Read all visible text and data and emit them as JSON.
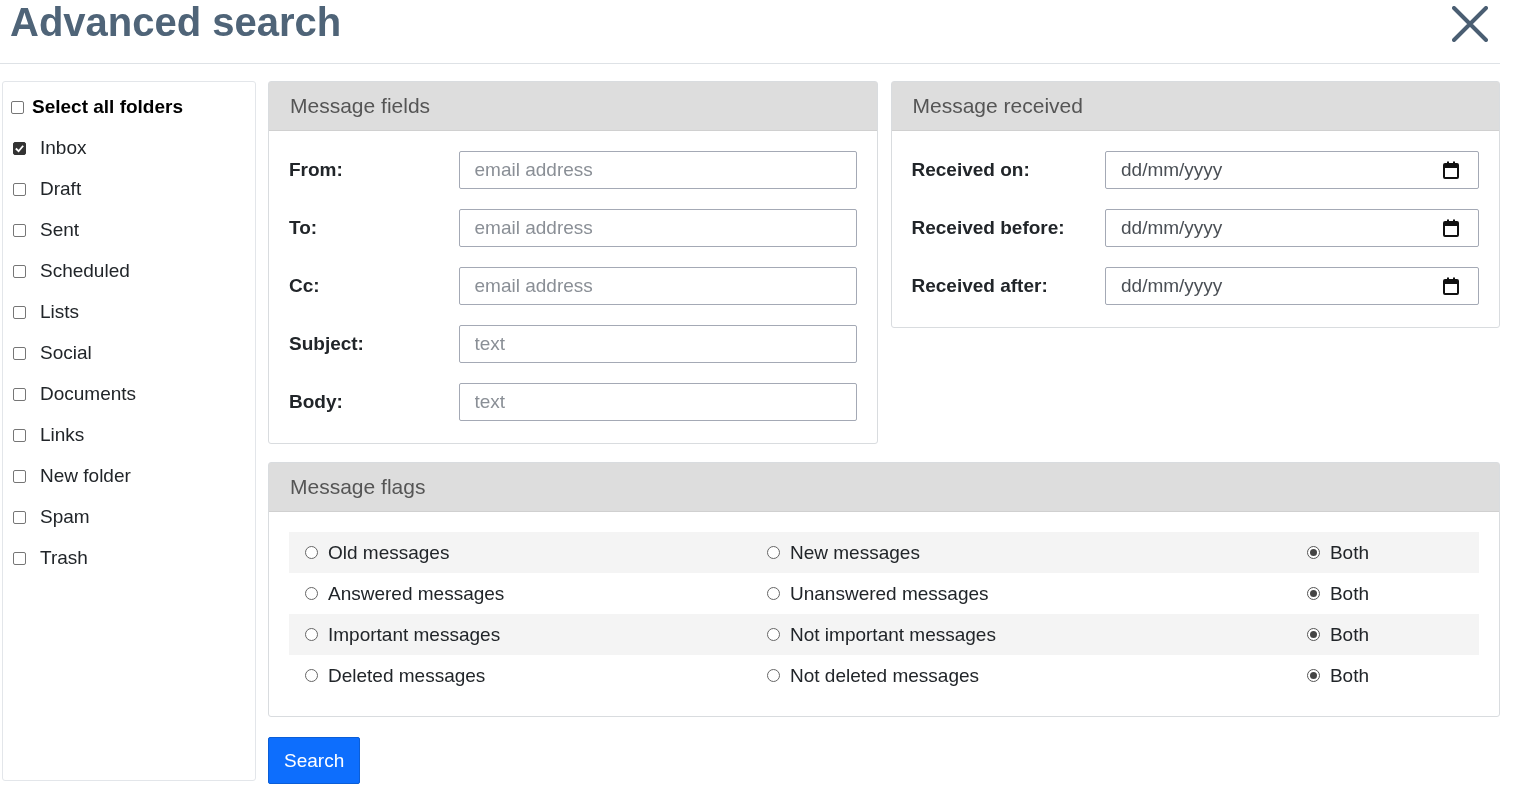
{
  "title": "Advanced search",
  "folders": {
    "select_all": {
      "label": "Select all folders",
      "checked": false
    },
    "items": [
      {
        "label": "Inbox",
        "checked": true
      },
      {
        "label": "Draft",
        "checked": false
      },
      {
        "label": "Sent",
        "checked": false
      },
      {
        "label": "Scheduled",
        "checked": false
      },
      {
        "label": "Lists",
        "checked": false
      },
      {
        "label": "Social",
        "checked": false
      },
      {
        "label": "Documents",
        "checked": false
      },
      {
        "label": "Links",
        "checked": false
      },
      {
        "label": "New folder",
        "checked": false
      },
      {
        "label": "Spam",
        "checked": false
      },
      {
        "label": "Trash",
        "checked": false
      }
    ]
  },
  "message_fields": {
    "title": "Message fields",
    "fields": [
      {
        "label": "From:",
        "placeholder": "email address"
      },
      {
        "label": "To:",
        "placeholder": "email address"
      },
      {
        "label": "Cc:",
        "placeholder": "email address"
      },
      {
        "label": "Subject:",
        "placeholder": "text"
      },
      {
        "label": "Body:",
        "placeholder": "text"
      }
    ]
  },
  "message_received": {
    "title": "Message received",
    "fields": [
      {
        "label": "Received on:",
        "placeholder": "dd/mm/yyyy"
      },
      {
        "label": "Received before:",
        "placeholder": "dd/mm/yyyy"
      },
      {
        "label": "Received after:",
        "placeholder": "dd/mm/yyyy"
      }
    ]
  },
  "message_flags": {
    "title": "Message flags",
    "rows": [
      {
        "options": [
          {
            "label": "Old messages",
            "selected": false
          },
          {
            "label": "New messages",
            "selected": false
          },
          {
            "label": "Both",
            "selected": true
          }
        ]
      },
      {
        "options": [
          {
            "label": "Answered messages",
            "selected": false
          },
          {
            "label": "Unanswered messages",
            "selected": false
          },
          {
            "label": "Both",
            "selected": true
          }
        ]
      },
      {
        "options": [
          {
            "label": "Important messages",
            "selected": false
          },
          {
            "label": "Not important messages",
            "selected": false
          },
          {
            "label": "Both",
            "selected": true
          }
        ]
      },
      {
        "options": [
          {
            "label": "Deleted messages",
            "selected": false
          },
          {
            "label": "Not deleted messages",
            "selected": false
          },
          {
            "label": "Both",
            "selected": true
          }
        ]
      }
    ]
  },
  "search_button": "Search"
}
